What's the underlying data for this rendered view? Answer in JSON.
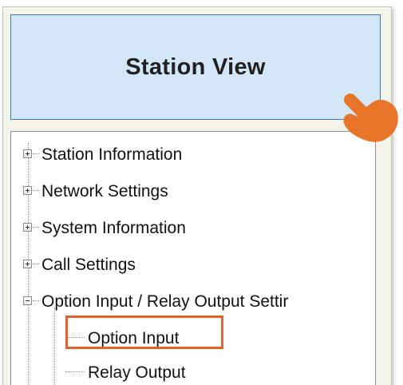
{
  "panel": {
    "title": "Station View"
  },
  "tree": {
    "items": [
      {
        "label": "Station Information",
        "expander": "plus"
      },
      {
        "label": "Network Settings",
        "expander": "plus"
      },
      {
        "label": "System Information",
        "expander": "plus"
      },
      {
        "label": "Call Settings",
        "expander": "plus"
      },
      {
        "label": "Option Input / Relay Output Settir",
        "expander": "minus"
      }
    ],
    "children": [
      {
        "label": "Option Input",
        "highlighted": true
      },
      {
        "label": "Relay Output",
        "highlighted": false
      }
    ]
  },
  "icons": {
    "pointer": "pointing-hand-icon",
    "expand": "plus-box-icon",
    "collapse": "minus-box-icon"
  },
  "colors": {
    "title_bg": "#d3e7f8",
    "title_border": "#3c7ab8",
    "highlight": "#e2642c",
    "hand": "#e8742a"
  }
}
